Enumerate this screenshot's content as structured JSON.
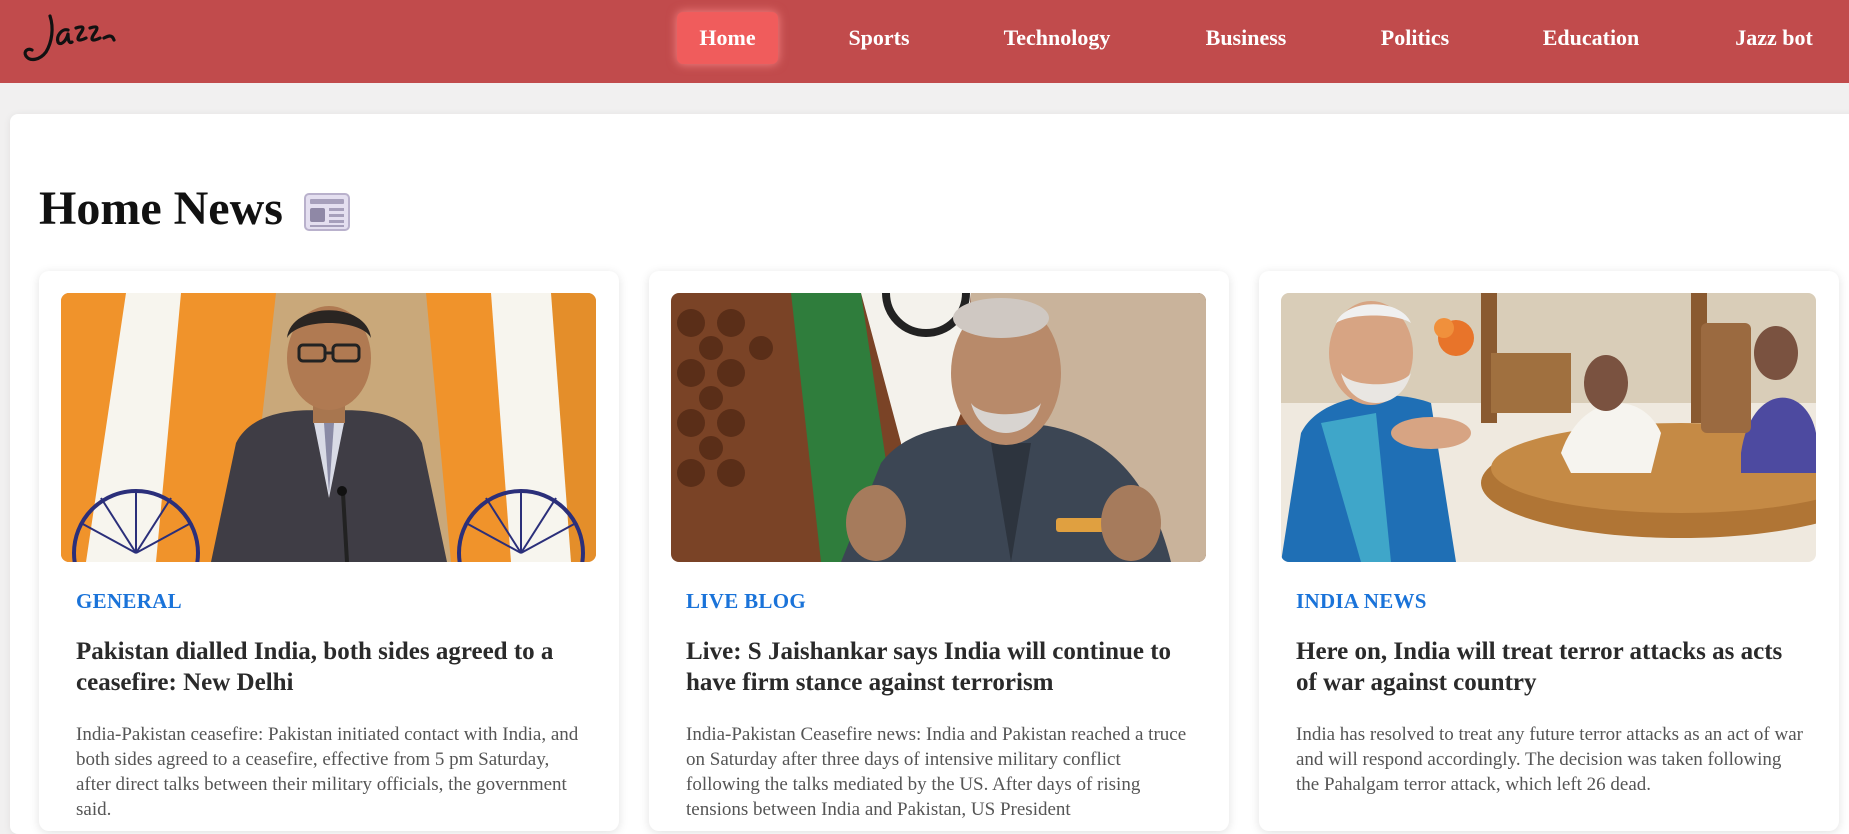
{
  "brand": {
    "logo_text": "Jazz"
  },
  "nav": {
    "items": [
      {
        "label": "Home",
        "active": true
      },
      {
        "label": "Sports"
      },
      {
        "label": "Technology"
      },
      {
        "label": "Business"
      },
      {
        "label": "Politics"
      },
      {
        "label": "Education"
      },
      {
        "label": "Jazz bot"
      }
    ]
  },
  "main": {
    "title": "Home News",
    "title_icon": "newspaper-icon",
    "articles": [
      {
        "category": "GENERAL",
        "headline": "Pakistan dialled India, both sides agreed to a ceasefire: New Delhi",
        "summary": "India-Pakistan ceasefire: Pakistan initiated contact with India, and both sides agreed to a ceasefire, effective from 5 pm Saturday, after direct talks between their military officials, the government said."
      },
      {
        "category": "LIVE BLOG",
        "headline": "Live: S Jaishankar says India will continue to have firm stance against terrorism",
        "summary": "India-Pakistan Ceasefire news: India and Pakistan reached a truce on Saturday after three days of intensive military conflict following the talks mediated by the US. After days of rising tensions between India and Pakistan, US President"
      },
      {
        "category": "INDIA NEWS",
        "headline": "Here on, India will treat terror attacks as acts of war against country",
        "summary": "India has resolved to treat any future terror attacks as an act of war and will respond accordingly. The decision was taken following the Pahalgam terror attack, which left 26 dead."
      }
    ]
  },
  "colors": {
    "navbar": "#c14b4c",
    "nav_active": "#f05c5c",
    "category": "#1a73d9"
  }
}
